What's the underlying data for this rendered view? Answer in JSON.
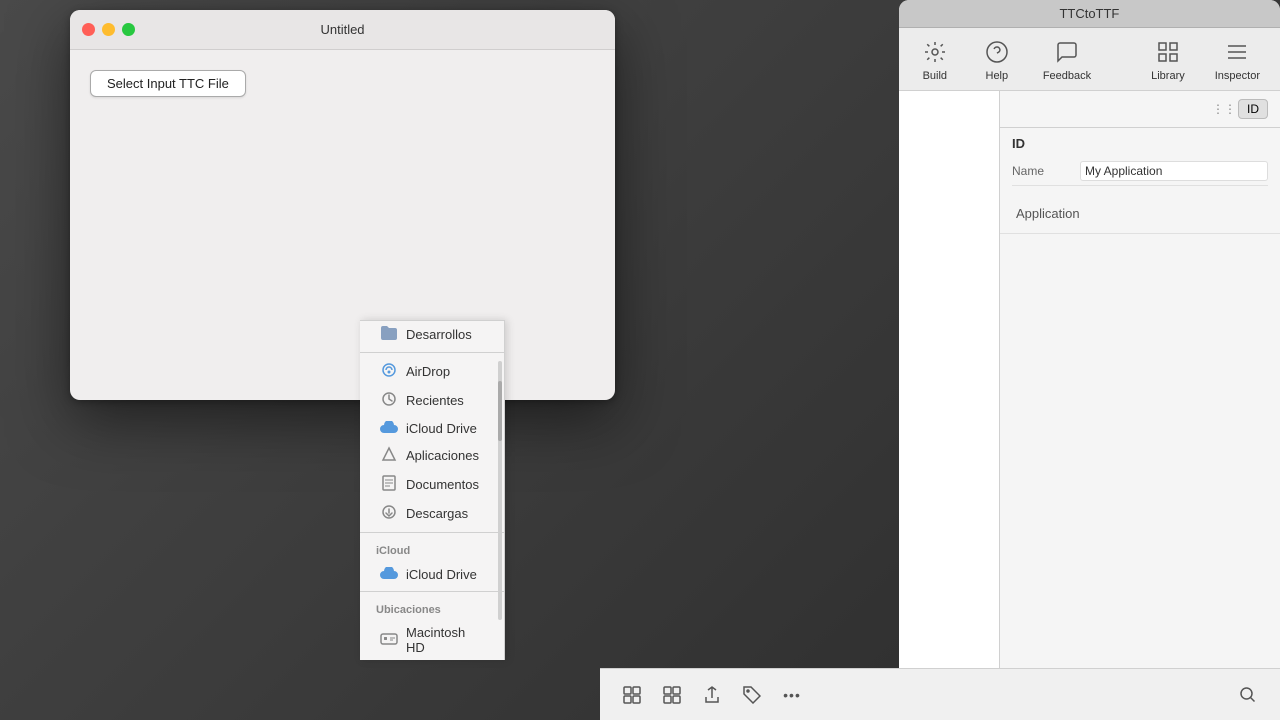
{
  "bg_app": {
    "title": "TTCtoTTF",
    "toolbar": {
      "build_icon": "⚙",
      "build_label": "Build",
      "help_icon": "?",
      "help_label": "Help",
      "feedback_icon": "↩",
      "feedback_label": "Feedback",
      "library_icon": "⊞",
      "library_label": "Library",
      "inspector_icon": "≡",
      "inspector_label": "Inspector"
    },
    "inspector": {
      "section_title": "ID",
      "id_button_label": "ID",
      "name_label": "Name",
      "name_value": "My Application"
    },
    "app_section_label": "Application"
  },
  "fg_window": {
    "title": "Untitled",
    "select_btn_label": "Select Input TTC File",
    "controls": {
      "close": "●",
      "minimize": "●",
      "maximize": "●"
    }
  },
  "sidebar": {
    "sections": [
      {
        "label": "",
        "items": [
          {
            "icon": "folder",
            "label": "Desarrollos"
          }
        ]
      },
      {
        "label": "",
        "items": [
          {
            "icon": "wifi",
            "label": "AirDrop"
          },
          {
            "icon": "clock",
            "label": "Recientes"
          },
          {
            "icon": "cloud",
            "label": "iCloud Drive"
          },
          {
            "icon": "triangle",
            "label": "Aplicaciones"
          },
          {
            "icon": "doc",
            "label": "Documentos"
          },
          {
            "icon": "arrow-down",
            "label": "Descargas"
          }
        ]
      },
      {
        "label": "iCloud",
        "items": [
          {
            "icon": "cloud",
            "label": "iCloud Drive"
          }
        ]
      },
      {
        "label": "Ubicaciones",
        "items": [
          {
            "icon": "hd",
            "label": "Macintosh HD"
          }
        ]
      }
    ]
  },
  "bottom_toolbar": {
    "grid_view": "⊞",
    "list_view": "☰",
    "share_icon": "↑",
    "tag_icon": "◇",
    "more_icon": "…",
    "search_icon": "🔍"
  },
  "colors": {
    "close_btn": "#ff5f57",
    "min_btn": "#febc2e",
    "max_btn": "#28c840",
    "accent": "#0066cc"
  }
}
